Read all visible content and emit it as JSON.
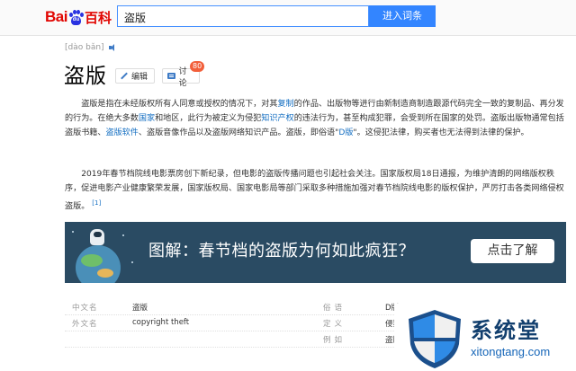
{
  "header": {
    "logo_text_left": "Bai",
    "logo_paw_text": "du",
    "logo_text_right": "百科",
    "search_value": "盗版",
    "search_button": "进入词条"
  },
  "entry": {
    "pinyin": "[dào bǎn]",
    "title": "盗版",
    "edit_label": "编辑",
    "discuss_label": "讨论",
    "discuss_count": "80"
  },
  "paragraphs": {
    "p1": {
      "a": "盗版是指在未经版权所有人同意或授权的情况下，对其",
      "link1": "复制",
      "b": "的作品、出版物等进行由新制造商制造跟源代码完全一致的复制品、再分发的行为。在绝大多数",
      "link2": "国家",
      "c": "和地区，此行为被定义为侵犯",
      "link3": "知识产权",
      "d": "的违法行为，甚至构成犯罪，会受到所在国家的处罚。盗版出版物通常包括盗版书籍、",
      "link4": "盗版软件",
      "e": "、盗版音像作品以及盗版网络知识产品。盗版，即俗语\"",
      "link5": "D版",
      "f": "\"。这侵犯法律，购买者也无法得到法律的保护。"
    },
    "p2": {
      "text": "2019年春节档院线电影票房创下新纪录，但电影的盗版传播问题也引起社会关注。国家版权局18日通报，为维护清朗的网络版权秩序，促进电影产业健康繁荣发展，国家版权局、国家电影局等部门采取多种措施加强对春节档院线电影的版权保护，严厉打击各类网络侵权盗版。",
      "ref": "[1]"
    }
  },
  "banner": {
    "text": "图解：春节档的盗版为何如此疯狂？",
    "button": "点击了解"
  },
  "basic_info": [
    {
      "k1": "中文名",
      "v1": "盗版",
      "k2": "俗语",
      "v2": "D版"
    },
    {
      "k1": "外文名",
      "v1": "copyright theft",
      "k2": "定义",
      "v2": "侵犯"
    },
    {
      "k1": "",
      "v1": "",
      "k2": "例如",
      "v2": "盗版"
    }
  ],
  "watermark": {
    "brand": "系统堂",
    "url": "xitongtang.com"
  },
  "colors": {
    "search_button": "#3385ff",
    "link": "#136ec2",
    "badge": "#f25f3a",
    "banner_bg": "#2a4b63"
  }
}
